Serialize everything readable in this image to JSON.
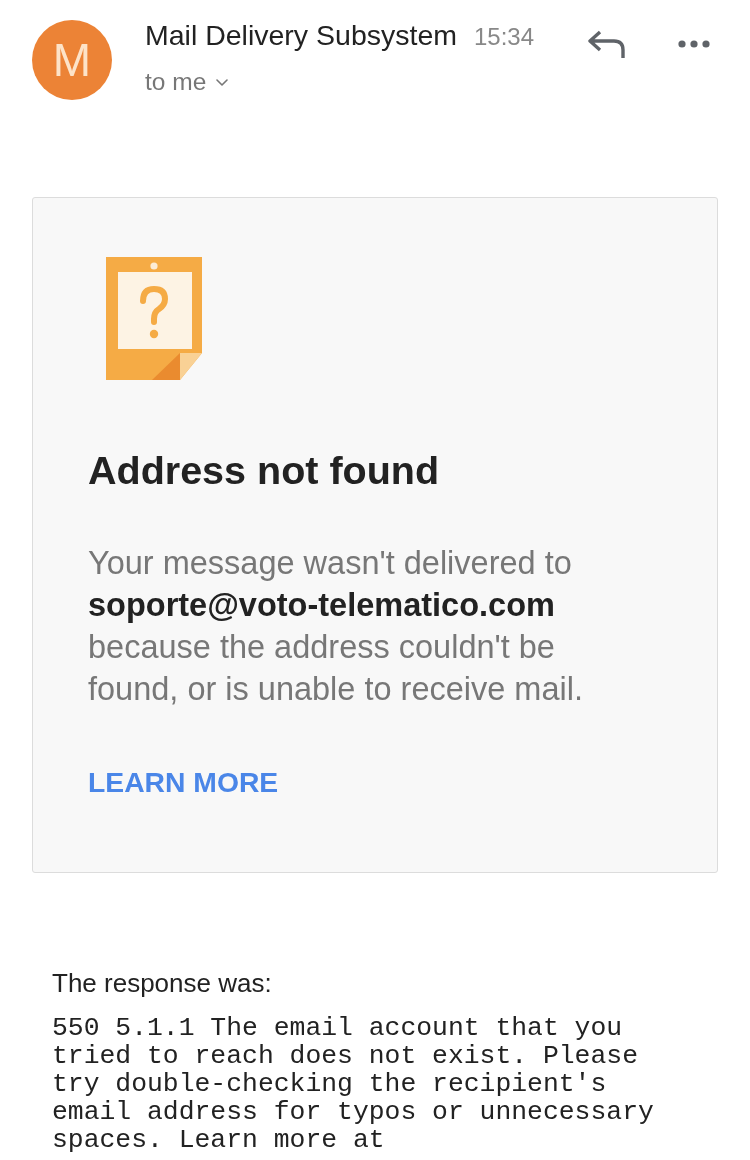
{
  "message": {
    "avatar_letter": "M",
    "sender": "Mail Delivery Subsystem",
    "time": "15:34",
    "recipient": "to me"
  },
  "card": {
    "title": "Address not found",
    "body": "Your message wasn't delivered to **soporte@voto-telematico.com** because the address couldn't be found, or is unable to receive mail.",
    "link": "LEARN MORE"
  },
  "response": {
    "label": "The response was:",
    "text": "550 5.1.1 The email account that you tried to reach does not exist. Please try double-checking the recipient's email address for typos or unnecessary spaces. Learn more at"
  }
}
